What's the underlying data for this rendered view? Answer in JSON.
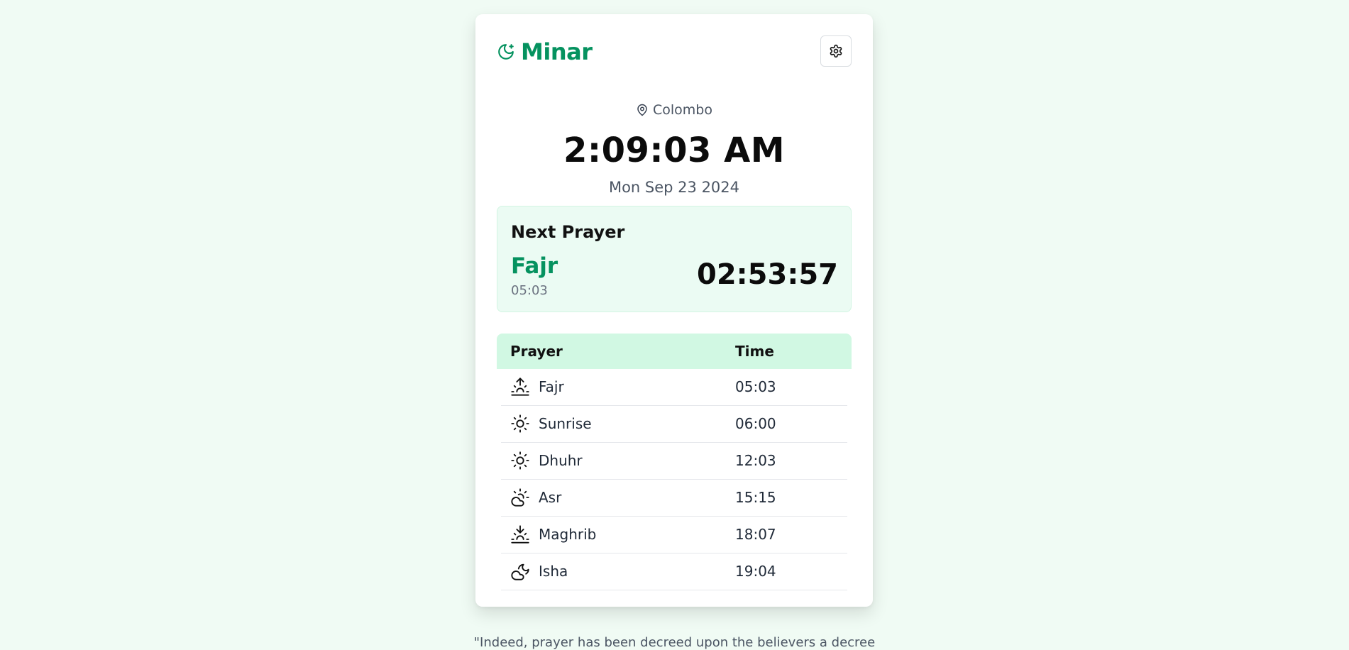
{
  "app": {
    "name": "Minar"
  },
  "header": {
    "settings_icon": "gear-icon",
    "brand_icon": "moon-star-icon"
  },
  "location": {
    "icon": "map-pin-icon",
    "city": "Colombo"
  },
  "clock": {
    "time": "2:09:03 AM",
    "date": "Mon Sep 23 2024"
  },
  "next_prayer": {
    "title": "Next Prayer",
    "name": "Fajr",
    "time": "05:03",
    "countdown": "02:53:57"
  },
  "table": {
    "headers": {
      "prayer": "Prayer",
      "time": "Time"
    },
    "rows": [
      {
        "icon": "sunrise-icon",
        "name": "Fajr",
        "time": "05:03"
      },
      {
        "icon": "sun-icon",
        "name": "Sunrise",
        "time": "06:00"
      },
      {
        "icon": "sun-icon",
        "name": "Dhuhr",
        "time": "12:03"
      },
      {
        "icon": "cloud-sun-icon",
        "name": "Asr",
        "time": "15:15"
      },
      {
        "icon": "sunset-icon",
        "name": "Maghrib",
        "time": "18:07"
      },
      {
        "icon": "cloud-moon-icon",
        "name": "Isha",
        "time": "19:04"
      }
    ]
  },
  "quote": {
    "text": "\"Indeed, prayer has been decreed upon the believers a decree"
  },
  "colors": {
    "accent": "#05925f",
    "background": "#f0fbf4",
    "next_box": "#ebfbf3",
    "table_header": "#d1f8e3"
  }
}
